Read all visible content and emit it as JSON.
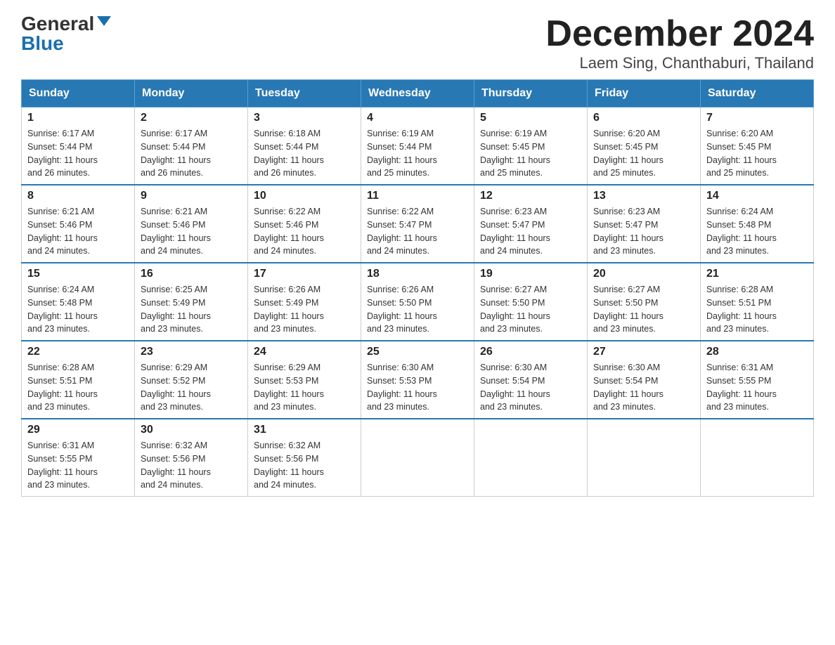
{
  "logo": {
    "general": "General",
    "blue": "Blue"
  },
  "title": "December 2024",
  "subtitle": "Laem Sing, Chanthaburi, Thailand",
  "days": [
    "Sunday",
    "Monday",
    "Tuesday",
    "Wednesday",
    "Thursday",
    "Friday",
    "Saturday"
  ],
  "weeks": [
    [
      {
        "day": "1",
        "sunrise": "6:17 AM",
        "sunset": "5:44 PM",
        "daylight": "11 hours and 26 minutes."
      },
      {
        "day": "2",
        "sunrise": "6:17 AM",
        "sunset": "5:44 PM",
        "daylight": "11 hours and 26 minutes."
      },
      {
        "day": "3",
        "sunrise": "6:18 AM",
        "sunset": "5:44 PM",
        "daylight": "11 hours and 26 minutes."
      },
      {
        "day": "4",
        "sunrise": "6:19 AM",
        "sunset": "5:44 PM",
        "daylight": "11 hours and 25 minutes."
      },
      {
        "day": "5",
        "sunrise": "6:19 AM",
        "sunset": "5:45 PM",
        "daylight": "11 hours and 25 minutes."
      },
      {
        "day": "6",
        "sunrise": "6:20 AM",
        "sunset": "5:45 PM",
        "daylight": "11 hours and 25 minutes."
      },
      {
        "day": "7",
        "sunrise": "6:20 AM",
        "sunset": "5:45 PM",
        "daylight": "11 hours and 25 minutes."
      }
    ],
    [
      {
        "day": "8",
        "sunrise": "6:21 AM",
        "sunset": "5:46 PM",
        "daylight": "11 hours and 24 minutes."
      },
      {
        "day": "9",
        "sunrise": "6:21 AM",
        "sunset": "5:46 PM",
        "daylight": "11 hours and 24 minutes."
      },
      {
        "day": "10",
        "sunrise": "6:22 AM",
        "sunset": "5:46 PM",
        "daylight": "11 hours and 24 minutes."
      },
      {
        "day": "11",
        "sunrise": "6:22 AM",
        "sunset": "5:47 PM",
        "daylight": "11 hours and 24 minutes."
      },
      {
        "day": "12",
        "sunrise": "6:23 AM",
        "sunset": "5:47 PM",
        "daylight": "11 hours and 24 minutes."
      },
      {
        "day": "13",
        "sunrise": "6:23 AM",
        "sunset": "5:47 PM",
        "daylight": "11 hours and 23 minutes."
      },
      {
        "day": "14",
        "sunrise": "6:24 AM",
        "sunset": "5:48 PM",
        "daylight": "11 hours and 23 minutes."
      }
    ],
    [
      {
        "day": "15",
        "sunrise": "6:24 AM",
        "sunset": "5:48 PM",
        "daylight": "11 hours and 23 minutes."
      },
      {
        "day": "16",
        "sunrise": "6:25 AM",
        "sunset": "5:49 PM",
        "daylight": "11 hours and 23 minutes."
      },
      {
        "day": "17",
        "sunrise": "6:26 AM",
        "sunset": "5:49 PM",
        "daylight": "11 hours and 23 minutes."
      },
      {
        "day": "18",
        "sunrise": "6:26 AM",
        "sunset": "5:50 PM",
        "daylight": "11 hours and 23 minutes."
      },
      {
        "day": "19",
        "sunrise": "6:27 AM",
        "sunset": "5:50 PM",
        "daylight": "11 hours and 23 minutes."
      },
      {
        "day": "20",
        "sunrise": "6:27 AM",
        "sunset": "5:50 PM",
        "daylight": "11 hours and 23 minutes."
      },
      {
        "day": "21",
        "sunrise": "6:28 AM",
        "sunset": "5:51 PM",
        "daylight": "11 hours and 23 minutes."
      }
    ],
    [
      {
        "day": "22",
        "sunrise": "6:28 AM",
        "sunset": "5:51 PM",
        "daylight": "11 hours and 23 minutes."
      },
      {
        "day": "23",
        "sunrise": "6:29 AM",
        "sunset": "5:52 PM",
        "daylight": "11 hours and 23 minutes."
      },
      {
        "day": "24",
        "sunrise": "6:29 AM",
        "sunset": "5:53 PM",
        "daylight": "11 hours and 23 minutes."
      },
      {
        "day": "25",
        "sunrise": "6:30 AM",
        "sunset": "5:53 PM",
        "daylight": "11 hours and 23 minutes."
      },
      {
        "day": "26",
        "sunrise": "6:30 AM",
        "sunset": "5:54 PM",
        "daylight": "11 hours and 23 minutes."
      },
      {
        "day": "27",
        "sunrise": "6:30 AM",
        "sunset": "5:54 PM",
        "daylight": "11 hours and 23 minutes."
      },
      {
        "day": "28",
        "sunrise": "6:31 AM",
        "sunset": "5:55 PM",
        "daylight": "11 hours and 23 minutes."
      }
    ],
    [
      {
        "day": "29",
        "sunrise": "6:31 AM",
        "sunset": "5:55 PM",
        "daylight": "11 hours and 23 minutes."
      },
      {
        "day": "30",
        "sunrise": "6:32 AM",
        "sunset": "5:56 PM",
        "daylight": "11 hours and 24 minutes."
      },
      {
        "day": "31",
        "sunrise": "6:32 AM",
        "sunset": "5:56 PM",
        "daylight": "11 hours and 24 minutes."
      },
      null,
      null,
      null,
      null
    ]
  ],
  "labels": {
    "sunrise": "Sunrise:",
    "sunset": "Sunset:",
    "daylight": "Daylight:"
  }
}
